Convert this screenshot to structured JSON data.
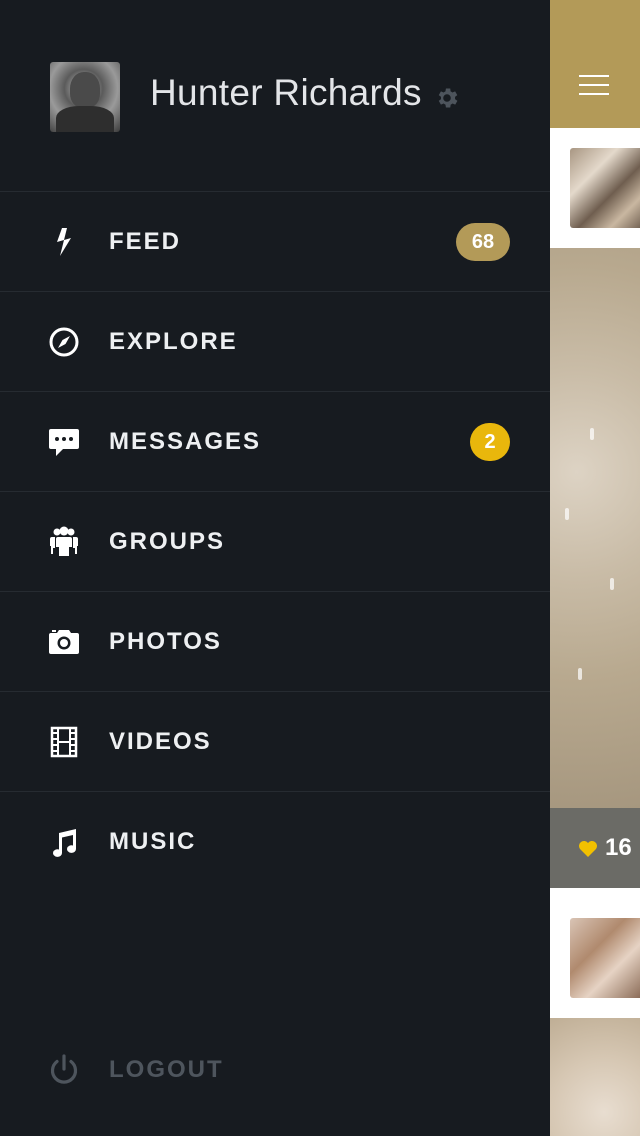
{
  "profile": {
    "name": "Hunter Richards"
  },
  "menu": {
    "items": [
      {
        "label": "FEED",
        "icon": "lightning-icon",
        "badge": "68",
        "badge_color": "#b39a58"
      },
      {
        "label": "EXPLORE",
        "icon": "compass-icon",
        "badge": null
      },
      {
        "label": "MESSAGES",
        "icon": "chat-bubble-icon",
        "badge": "2",
        "badge_color": "#e9b70c"
      },
      {
        "label": "GROUPS",
        "icon": "people-icon",
        "badge": null
      },
      {
        "label": "PHOTOS",
        "icon": "camera-icon",
        "badge": null
      },
      {
        "label": "VIDEOS",
        "icon": "film-icon",
        "badge": null
      },
      {
        "label": "MUSIC",
        "icon": "music-note-icon",
        "badge": null
      }
    ],
    "logout": {
      "label": "LOGOUT",
      "icon": "power-icon"
    }
  },
  "content": {
    "likes_count": "16"
  },
  "colors": {
    "drawer_bg": "#171b20",
    "accent_gold": "#b39a58",
    "accent_yellow": "#e9b70c"
  }
}
